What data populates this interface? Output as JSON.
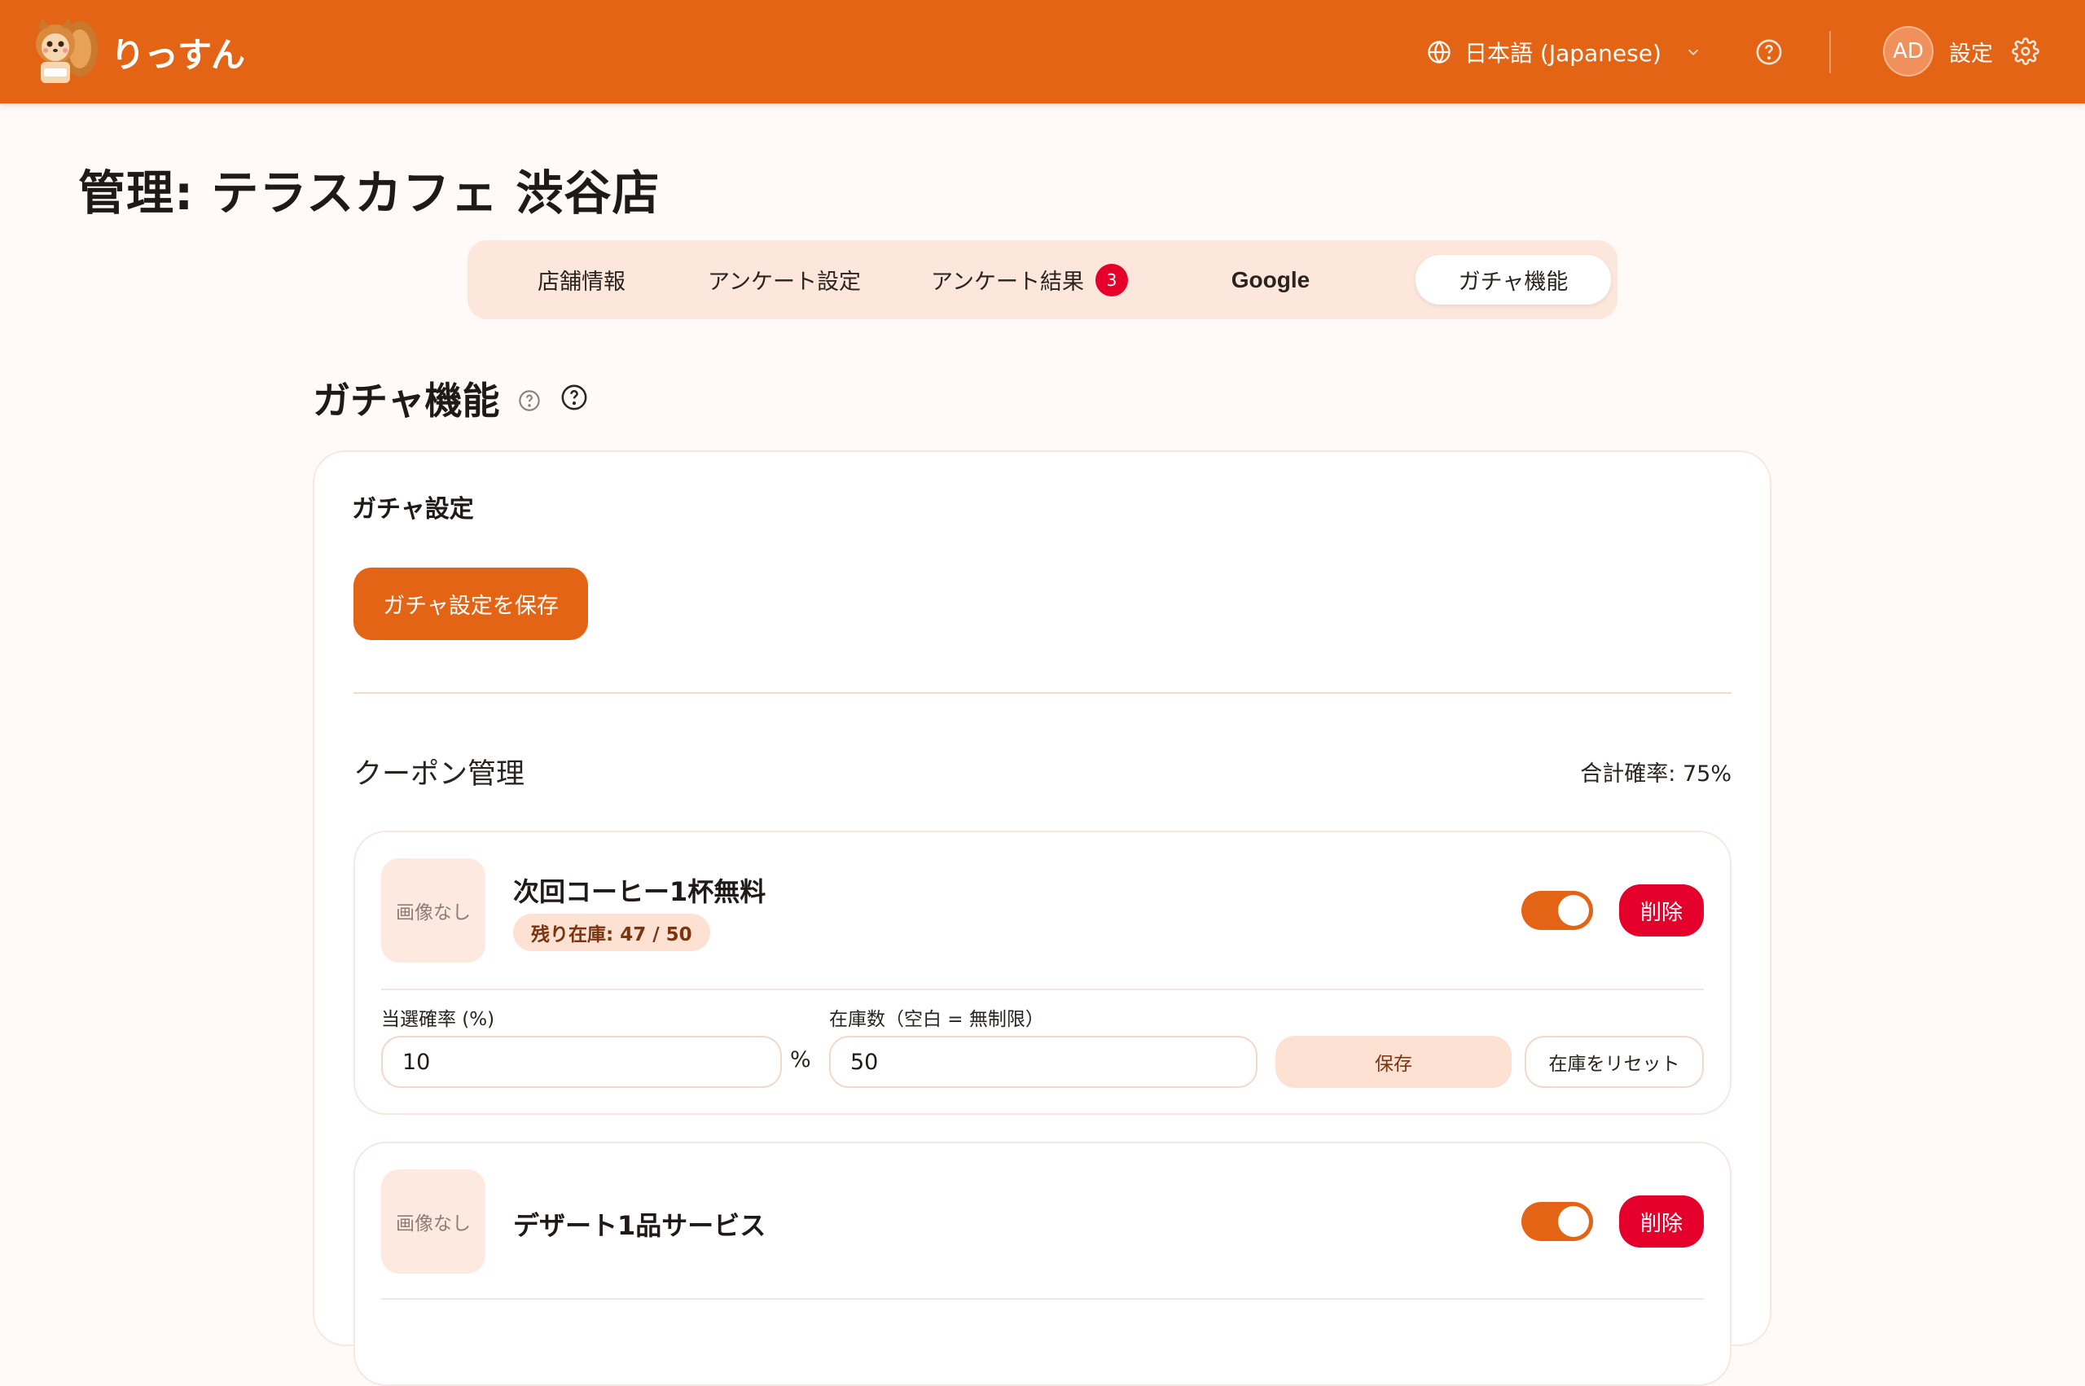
{
  "header": {
    "brand": "りっすん",
    "logo_icon": "squirrel-mascot-icon",
    "language": "日本語 (Japanese)",
    "avatar_initials": "AD",
    "settings_label": "設定",
    "colors": {
      "brand": "#e36414",
      "danger": "#e4002b"
    }
  },
  "page": {
    "title": "管理: テラスカフェ 渋谷店"
  },
  "tabs": [
    {
      "label": "店舗情報"
    },
    {
      "label": "アンケート設定"
    },
    {
      "label": "アンケート結果",
      "badge": "3"
    },
    {
      "label": "Google"
    },
    {
      "label": "ガチャ機能",
      "active": true
    }
  ],
  "section": {
    "title": "ガチャ機能",
    "gacha_settings_title": "ガチャ設定",
    "save_gacha_label": "ガチャ設定を保存",
    "coupon_mgmt_title": "クーポン管理",
    "total_probability": "合計確率: 75%"
  },
  "coupons": [
    {
      "image_placeholder": "画像なし",
      "name": "次回コーヒー1杯無料",
      "stock_label": "残り在庫: 47 / 50",
      "enabled": true,
      "delete_label": "削除",
      "prob_label": "当選確率 (%)",
      "prob_value": "10",
      "pct_unit": "%",
      "stock_field_label": "在庫数（空白 = 無制限）",
      "stock_value": "50",
      "save_label": "保存",
      "reset_label": "在庫をリセット"
    },
    {
      "image_placeholder": "画像なし",
      "name": "デザート1品サービス",
      "enabled": true,
      "delete_label": "削除"
    }
  ]
}
